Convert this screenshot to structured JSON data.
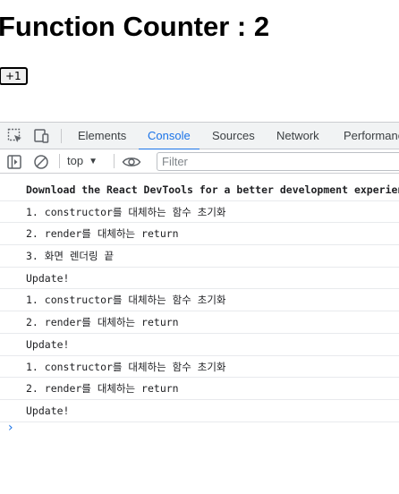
{
  "app": {
    "title": "Function Counter : 2",
    "increment_label": "+1"
  },
  "devtools": {
    "tabs": [
      {
        "label": "Elements",
        "active": false
      },
      {
        "label": "Console",
        "active": true
      },
      {
        "label": "Sources",
        "active": false
      },
      {
        "label": "Network",
        "active": false
      },
      {
        "label": "Performance",
        "active": false
      }
    ],
    "toolbar": {
      "context": "top",
      "filter_placeholder": "Filter"
    },
    "console_messages": [
      "Download the React DevTools for a better development experience",
      "1. constructor를 대체하는 함수 초기화",
      "2. render를 대체하는 return",
      "3. 화면 렌더링 끝",
      "Update!",
      "1. constructor를 대체하는 함수 초기화",
      "2. render를 대체하는 return",
      "Update!",
      "1. constructor를 대체하는 함수 초기화",
      "2. render를 대체하는 return",
      "Update!"
    ],
    "prompt_symbol": "›"
  },
  "icons": {
    "inspect": "inspect-element-icon",
    "device": "device-toolbar-icon",
    "sidebar": "show-sidebar-icon",
    "clear": "clear-console-icon",
    "eye": "live-expression-eye-icon"
  },
  "colors": {
    "accent": "#1a73e8",
    "tabbar_bg": "#f1f3f4",
    "divider": "#e8eaed"
  }
}
